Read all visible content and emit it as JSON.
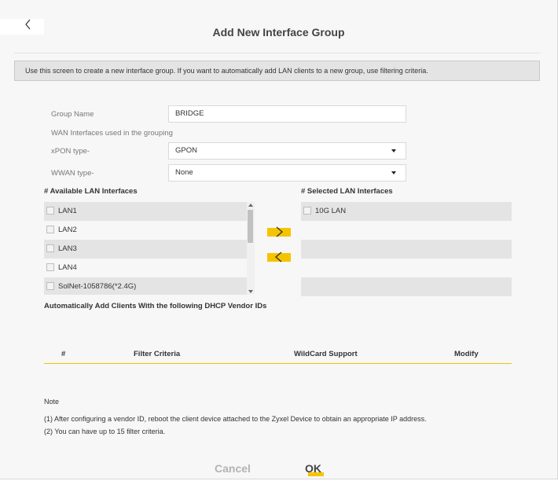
{
  "header": {
    "title": "Add New Interface Group"
  },
  "info": {
    "text": "Use this screen to create a new interface group. If you want to automatically add LAN clients to a new group, use filtering criteria."
  },
  "form": {
    "group_name_label": "Group Name",
    "group_name_value": "BRIDGE",
    "wan_label": "WAN Interfaces used in the grouping",
    "xpon_label": "xPON type-",
    "xpon_value": "GPON",
    "wwan_label": "WWAN type-",
    "wwan_value": "None"
  },
  "available": {
    "title": "# Available LAN Interfaces",
    "items": [
      {
        "label": "LAN1"
      },
      {
        "label": "LAN2"
      },
      {
        "label": "LAN3"
      },
      {
        "label": "LAN4"
      },
      {
        "label": "SolNet-1058786(*2.4G)"
      }
    ]
  },
  "selected": {
    "title": "# Selected LAN Interfaces",
    "items": [
      {
        "label": "10G LAN"
      }
    ]
  },
  "dhcp": {
    "title": "Automatically Add Clients With the following DHCP Vendor IDs",
    "columns": [
      "#",
      "Filter Criteria",
      "WildCard Support",
      "Modify"
    ]
  },
  "note": {
    "title": "Note",
    "line1": "(1) After configuring a vendor ID, reboot the client device attached to the Zyxel Device to obtain an appropriate IP address.",
    "line2": "(2) You can have up to 15 filter criteria."
  },
  "actions": {
    "cancel": "Cancel",
    "ok": "OK"
  },
  "colors": {
    "accent": "#f5c400",
    "panel": "#f7f7f7",
    "row_shade": "#e4e4e4"
  }
}
